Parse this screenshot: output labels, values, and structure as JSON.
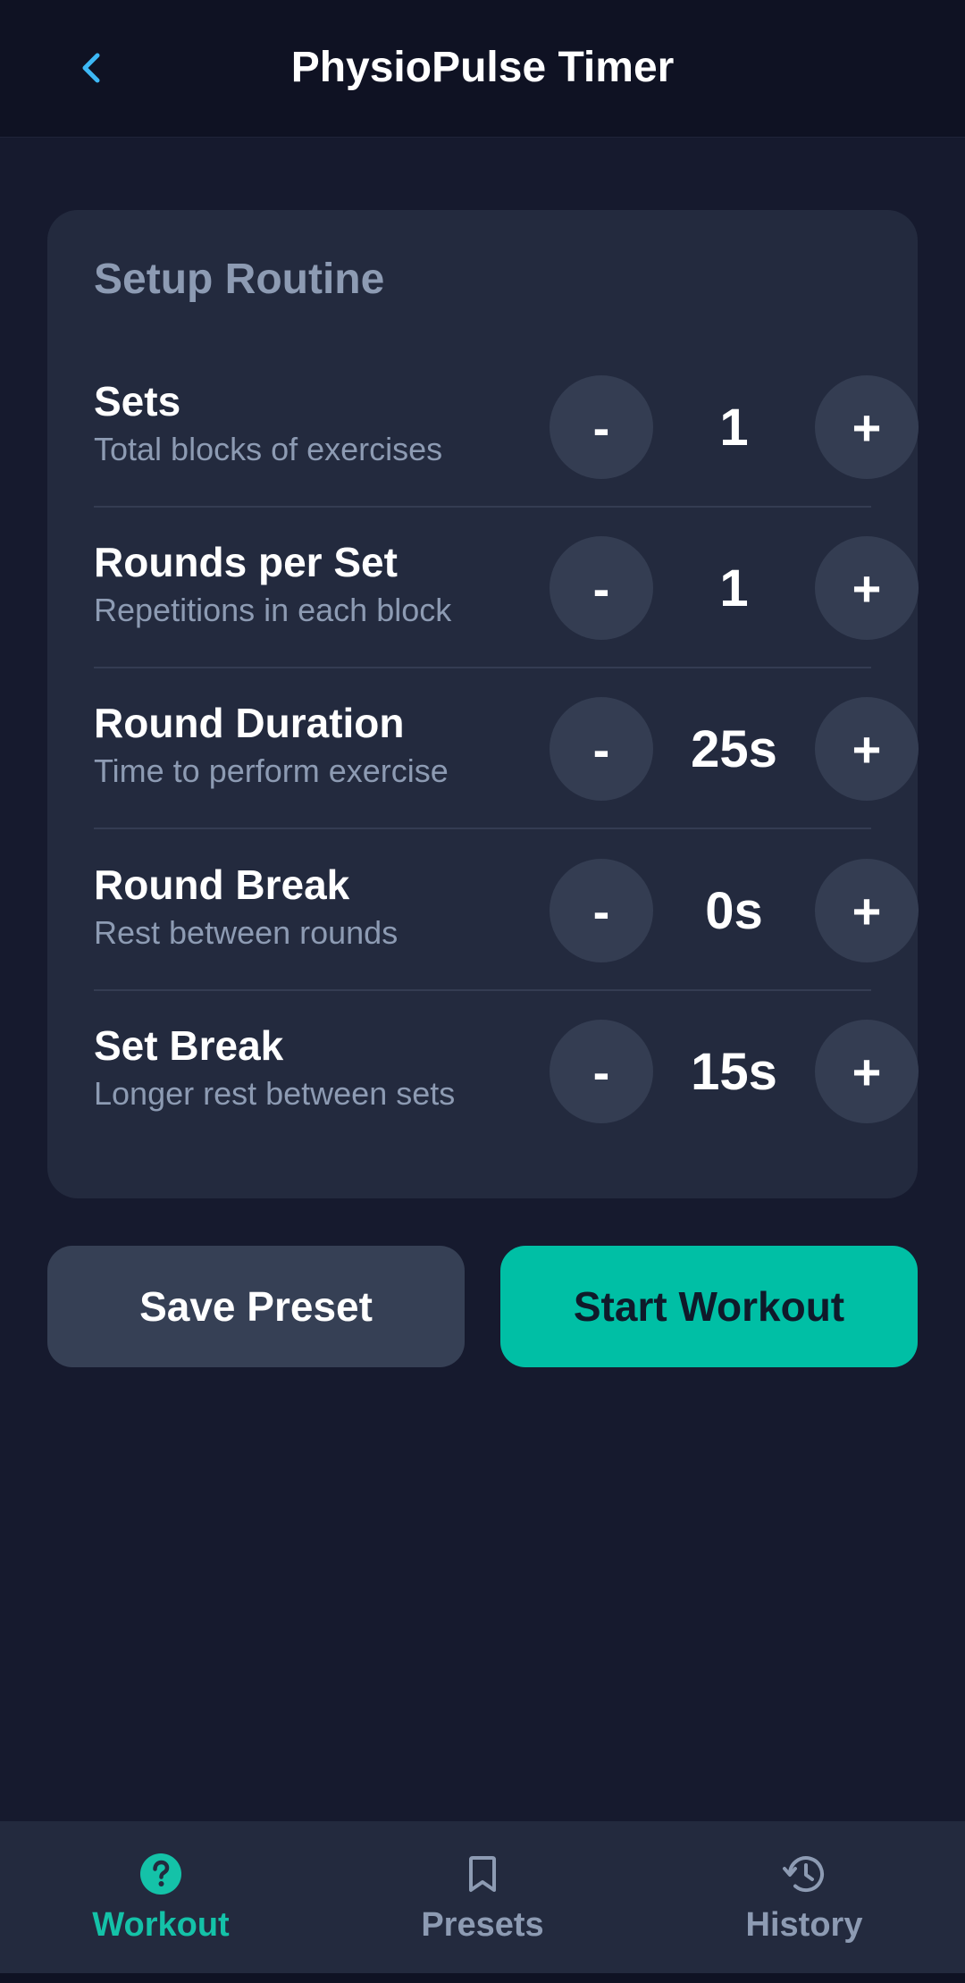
{
  "header": {
    "title": "PhysioPulse Timer",
    "back_icon": "chevron-left-icon",
    "accent_color": "#3db8f5"
  },
  "setup": {
    "title": "Setup Routine",
    "rows": [
      {
        "label": "Sets",
        "description": "Total blocks of exercises",
        "value": "1",
        "minus": "-",
        "plus": "+"
      },
      {
        "label": "Rounds per Set",
        "description": "Repetitions in each block",
        "value": "1",
        "minus": "-",
        "plus": "+"
      },
      {
        "label": "Round Duration",
        "description": "Time to perform exercise",
        "value": "25s",
        "minus": "-",
        "plus": "+"
      },
      {
        "label": "Round Break",
        "description": "Rest between rounds",
        "value": "0s",
        "minus": "-",
        "plus": "+"
      },
      {
        "label": "Set Break",
        "description": "Longer rest between sets",
        "value": "15s",
        "minus": "-",
        "plus": "+"
      }
    ]
  },
  "actions": {
    "save_label": "Save Preset",
    "start_label": "Start Workout",
    "start_color": "#00bfa5"
  },
  "nav": {
    "items": [
      {
        "label": "Workout",
        "icon": "help-circle-icon",
        "active": true
      },
      {
        "label": "Presets",
        "icon": "bookmark-icon",
        "active": false
      },
      {
        "label": "History",
        "icon": "history-icon",
        "active": false
      }
    ],
    "active_color": "#14c2a8"
  }
}
